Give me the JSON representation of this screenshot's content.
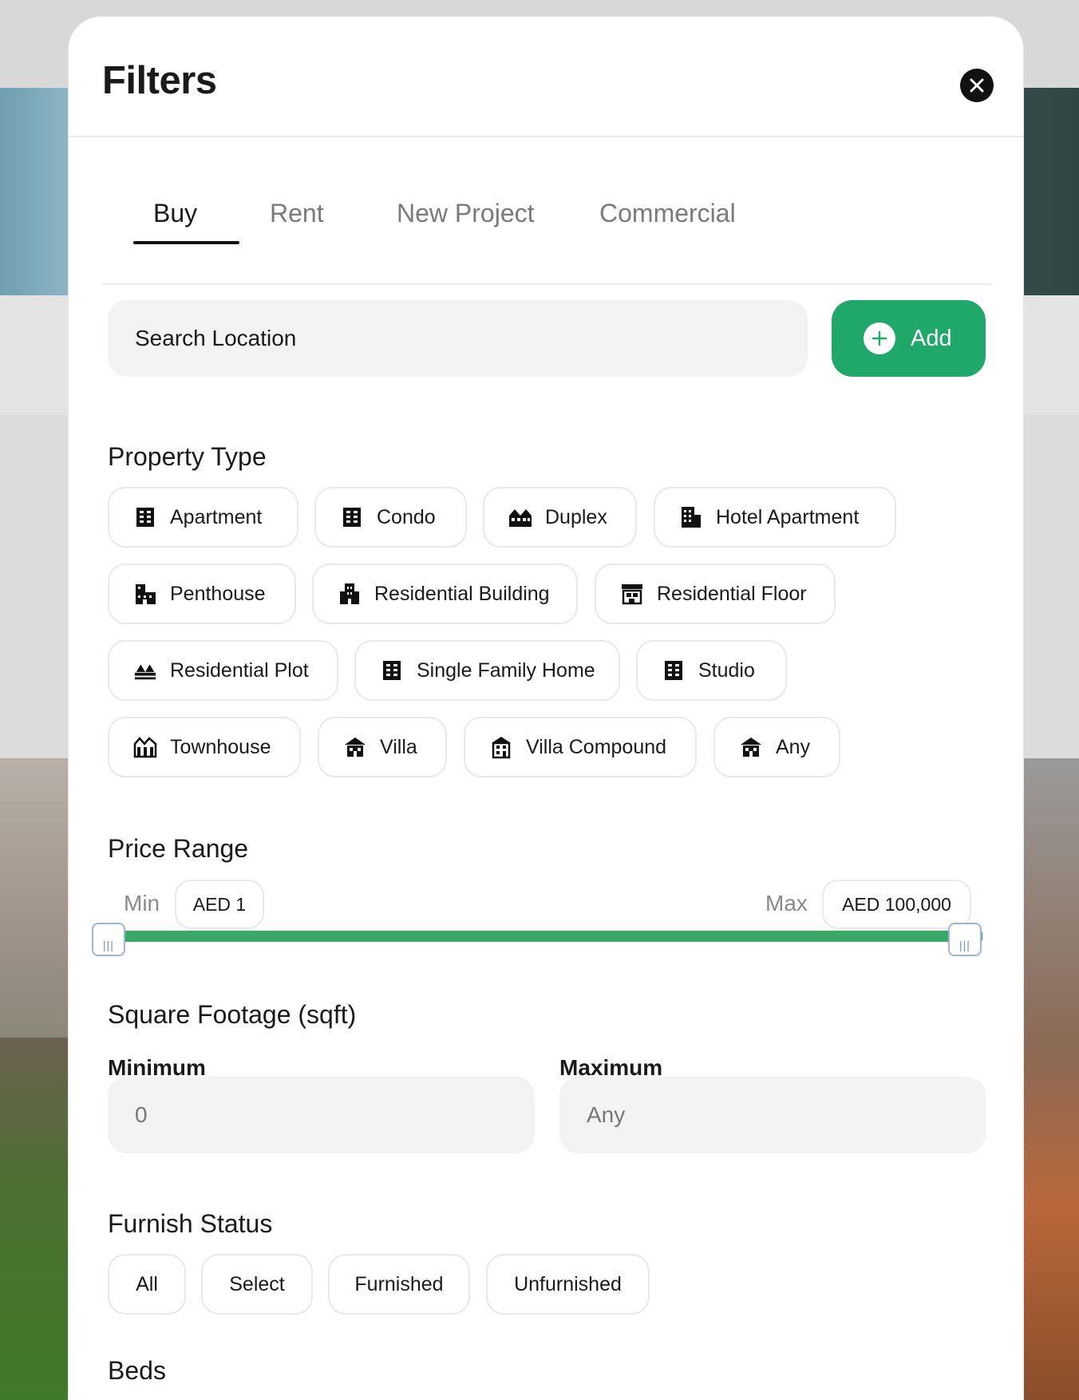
{
  "header": {
    "title": "Filters"
  },
  "tabs": [
    {
      "label": "Buy",
      "active": true
    },
    {
      "label": "Rent",
      "active": false
    },
    {
      "label": "New Project",
      "active": false
    },
    {
      "label": "Commercial",
      "active": false
    }
  ],
  "search": {
    "placeholder": "Search Location",
    "add_label": "Add"
  },
  "property_type": {
    "title": "Property Type",
    "items": [
      {
        "label": "Apartment",
        "icon": "apartment-icon"
      },
      {
        "label": "Condo",
        "icon": "condo-icon"
      },
      {
        "label": "Duplex",
        "icon": "duplex-icon"
      },
      {
        "label": "Hotel Apartment",
        "icon": "hotel-apartment-icon"
      },
      {
        "label": "Penthouse",
        "icon": "penthouse-icon"
      },
      {
        "label": "Residential Building",
        "icon": "residential-building-icon"
      },
      {
        "label": "Residential Floor",
        "icon": "residential-floor-icon"
      },
      {
        "label": "Residential Plot",
        "icon": "residential-plot-icon"
      },
      {
        "label": "Single Family Home",
        "icon": "single-family-home-icon"
      },
      {
        "label": "Studio",
        "icon": "studio-icon"
      },
      {
        "label": "Townhouse",
        "icon": "townhouse-icon"
      },
      {
        "label": "Villa",
        "icon": "villa-icon"
      },
      {
        "label": "Villa Compound",
        "icon": "villa-compound-icon"
      },
      {
        "label": "Any",
        "icon": "any-icon"
      }
    ]
  },
  "price_range": {
    "title": "Price Range",
    "min_label": "Min",
    "min_value": "AED 1",
    "max_label": "Max",
    "max_value": "AED 100,000",
    "slider_min_fraction": 0,
    "slider_max_fraction": 1,
    "accent_color": "#3aa968"
  },
  "square_footage": {
    "title": "Square Footage (sqft)",
    "minimum_label": "Minimum",
    "minimum_placeholder": "0",
    "maximum_label": "Maximum",
    "maximum_placeholder": "Any"
  },
  "furnish_status": {
    "title": "Furnish Status",
    "options": [
      "All",
      "Select",
      "Furnished",
      "Unfurnished"
    ]
  },
  "beds": {
    "title": "Beds"
  },
  "colors": {
    "brand_green": "#1fa86a"
  }
}
